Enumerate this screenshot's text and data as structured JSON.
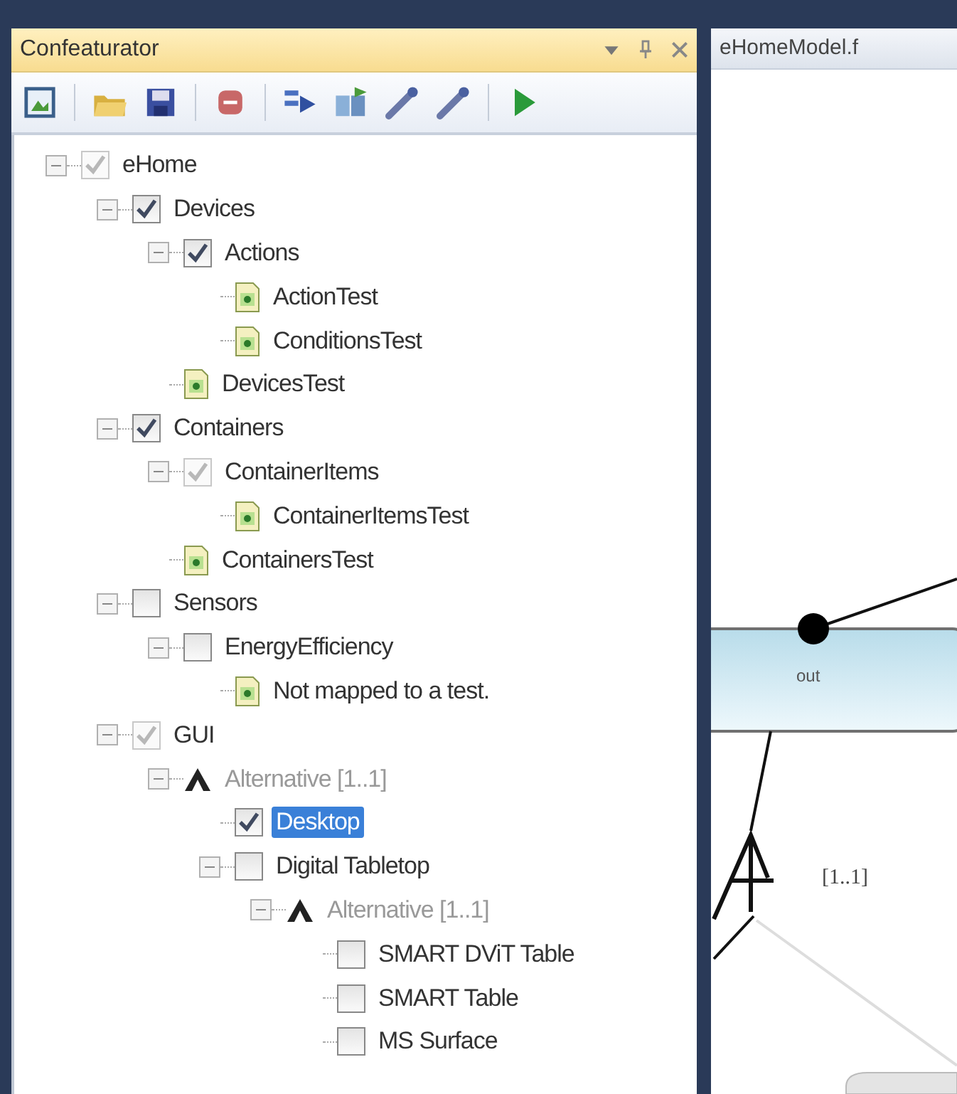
{
  "panel": {
    "title": "Confeaturator"
  },
  "toolbar": [
    {
      "kind": "new"
    },
    {
      "kind": "separator"
    },
    {
      "kind": "open"
    },
    {
      "kind": "save"
    },
    {
      "kind": "separator"
    },
    {
      "kind": "delete"
    },
    {
      "kind": "separator"
    },
    {
      "kind": "map"
    },
    {
      "kind": "import"
    },
    {
      "kind": "wand"
    },
    {
      "kind": "wand"
    },
    {
      "kind": "separator"
    },
    {
      "kind": "run"
    }
  ],
  "tree": [
    {
      "kind": "feature",
      "label": "eHome",
      "checked": true,
      "disabled": true,
      "selected": false,
      "expanded": true,
      "children": [
        {
          "kind": "feature",
          "label": "Devices",
          "checked": true,
          "disabled": false,
          "selected": false,
          "expanded": true,
          "children": [
            {
              "kind": "feature",
              "label": "Actions",
              "checked": true,
              "disabled": false,
              "selected": false,
              "expanded": true,
              "children": [
                {
                  "kind": "test",
                  "label": "ActionTest"
                },
                {
                  "kind": "test",
                  "label": "ConditionsTest"
                }
              ]
            },
            {
              "kind": "test",
              "label": "DevicesTest"
            }
          ]
        },
        {
          "kind": "feature",
          "label": "Containers",
          "checked": true,
          "disabled": false,
          "selected": false,
          "expanded": true,
          "children": [
            {
              "kind": "feature",
              "label": "ContainerItems",
              "checked": true,
              "disabled": true,
              "selected": false,
              "expanded": true,
              "children": [
                {
                  "kind": "test",
                  "label": "ContainerItemsTest"
                }
              ]
            },
            {
              "kind": "test",
              "label": "ContainersTest"
            }
          ]
        },
        {
          "kind": "feature",
          "label": "Sensors",
          "checked": false,
          "disabled": false,
          "selected": false,
          "expanded": true,
          "children": [
            {
              "kind": "feature",
              "label": "EnergyEfficiency",
              "checked": false,
              "disabled": false,
              "selected": false,
              "expanded": true,
              "children": [
                {
                  "kind": "test",
                  "label": "Not mapped to a test."
                }
              ]
            }
          ]
        },
        {
          "kind": "feature",
          "label": "GUI",
          "checked": true,
          "disabled": true,
          "selected": false,
          "expanded": true,
          "children": [
            {
              "kind": "group",
              "label": "Alternative [1..1]",
              "expanded": true,
              "children": [
                {
                  "kind": "feature",
                  "label": "Desktop",
                  "checked": true,
                  "disabled": false,
                  "selected": true
                },
                {
                  "kind": "feature",
                  "label": "Digital Tabletop",
                  "checked": false,
                  "disabled": false,
                  "selected": false,
                  "expanded": true,
                  "children": [
                    {
                      "kind": "group",
                      "label": "Alternative [1..1]",
                      "expanded": true,
                      "children": [
                        {
                          "kind": "feature",
                          "label": "SMART DViT Table",
                          "checked": false,
                          "disabled": false,
                          "selected": false
                        },
                        {
                          "kind": "feature",
                          "label": "SMART Table",
                          "checked": false,
                          "disabled": false,
                          "selected": false
                        },
                        {
                          "kind": "feature",
                          "label": "MS Surface",
                          "checked": false,
                          "disabled": false,
                          "selected": false
                        }
                      ]
                    }
                  ]
                }
              ]
            }
          ]
        }
      ]
    }
  ],
  "document": {
    "tab": "eHomeModel.f",
    "node_label": "out",
    "cardinality": "[1..1]"
  }
}
